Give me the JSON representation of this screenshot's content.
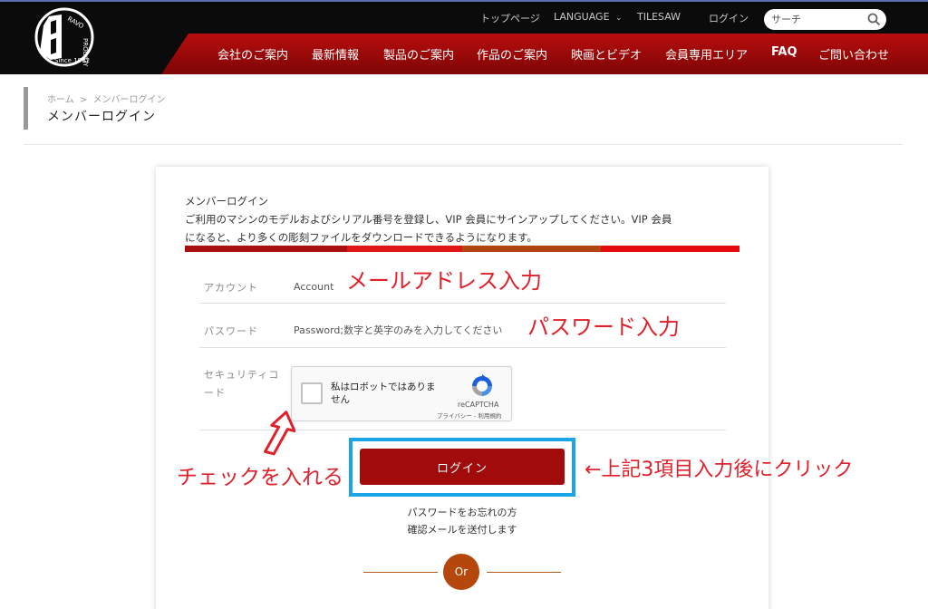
{
  "header": {
    "logo_alt": "BRAVOPRODIGY",
    "logo_since": "Since 1982",
    "top_links": [
      "トップページ",
      "LANGUAGE",
      "TILESAW",
      "ログイン"
    ],
    "search_placeholder": "サーチ",
    "nav": [
      "会社のご案内",
      "最新情報",
      "製品のご案内",
      "作品のご案内",
      "映画とビデオ",
      "会員専用エリア",
      "FAQ",
      "ご問い合わせ"
    ]
  },
  "breadcrumb": [
    "ホーム",
    ">",
    "メンバーログイン"
  ],
  "page_title": "メンバーログイン",
  "card": {
    "intro_title": "メンバーログイン",
    "intro_line1": "ご利用のマシンのモデルおよびシリアル番号を登録し、VIP 会員にサインアップしてください。VIP 会員",
    "intro_line2": "になると、より多くの彫刻ファイルをダウンロードできるようになります。",
    "account_label": "アカウント",
    "account_placeholder": "Account",
    "password_label": "パスワード",
    "password_placeholder": "Password;数字と英字のみを入力してください",
    "security_label_1": "セキュリティコ",
    "security_label_2": "ード",
    "captcha_text": "私はロボットではありません",
    "captcha_brand": "reCAPTCHA",
    "captcha_links": "プライバシー - 利用規約",
    "login_button": "ログイン",
    "forgot_line1": "パスワードをお忘れの方",
    "forgot_line2": "確認メールを送付します",
    "or_label": "Or"
  },
  "annotations": {
    "email": "メールアドレス入力",
    "password": "パスワード入力",
    "check": "チェックを入れる",
    "click": "←上記3項目入力後にクリック"
  },
  "colors": {
    "header_bg": "#0b0b0b",
    "header_red": "#b80d0d",
    "login_button": "#a10b0b",
    "highlight": "#1aa6e6",
    "annotation": "#e0202a",
    "or_circle": "#b5470d"
  }
}
